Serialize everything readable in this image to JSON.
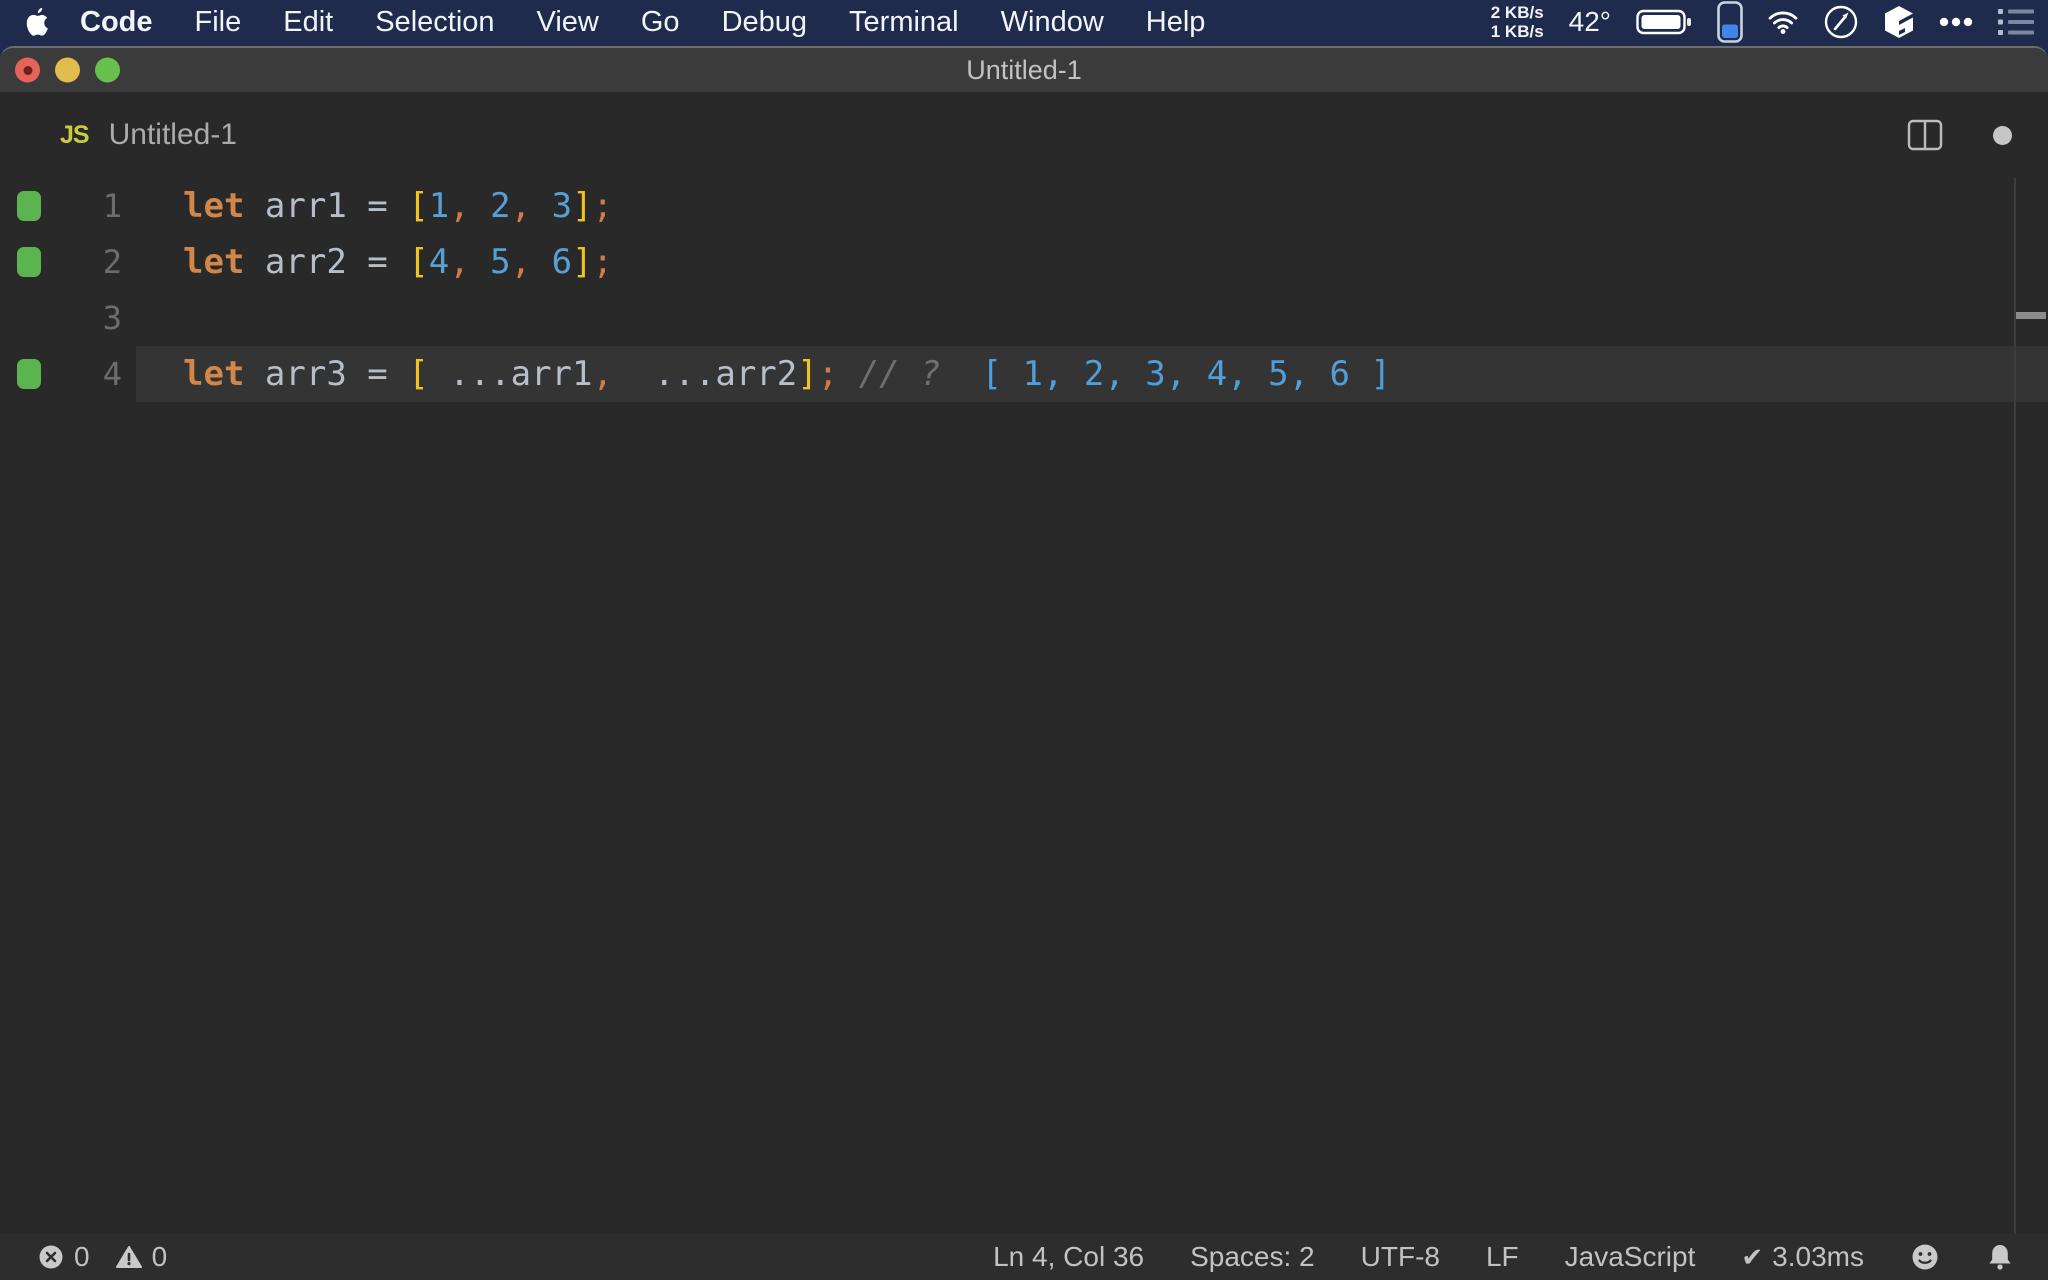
{
  "menu_bar": {
    "items": [
      {
        "label": "Code",
        "active": true
      },
      {
        "label": "File"
      },
      {
        "label": "Edit"
      },
      {
        "label": "Selection"
      },
      {
        "label": "View"
      },
      {
        "label": "Go"
      },
      {
        "label": "Debug"
      },
      {
        "label": "Terminal"
      },
      {
        "label": "Window"
      },
      {
        "label": "Help"
      }
    ],
    "status": {
      "network_up": "2 KB/s",
      "network_down": "1 KB/s",
      "temperature": "42°",
      "icons": [
        "battery-icon",
        "device-battery-icon",
        "wifi-icon",
        "compass-icon",
        "cube-icon",
        "more-dots-icon",
        "list-icon"
      ]
    }
  },
  "window": {
    "title": "Untitled-1",
    "tab": {
      "icon_label": "JS",
      "file_name": "Untitled-1"
    }
  },
  "editor": {
    "lines": [
      {
        "number": "1",
        "executed": true,
        "current": false,
        "tokens": [
          {
            "c": "keyword",
            "t": "let"
          },
          {
            "c": "plain",
            "t": " "
          },
          {
            "c": "variable",
            "t": "arr1"
          },
          {
            "c": "operator",
            "t": " = "
          },
          {
            "c": "bracket",
            "t": "["
          },
          {
            "c": "number",
            "t": "1"
          },
          {
            "c": "punct",
            "t": ", "
          },
          {
            "c": "number",
            "t": "2"
          },
          {
            "c": "punct",
            "t": ", "
          },
          {
            "c": "number",
            "t": "3"
          },
          {
            "c": "bracket",
            "t": "]"
          },
          {
            "c": "punct",
            "t": ";"
          }
        ]
      },
      {
        "number": "2",
        "executed": true,
        "current": false,
        "tokens": [
          {
            "c": "keyword",
            "t": "let"
          },
          {
            "c": "plain",
            "t": " "
          },
          {
            "c": "variable",
            "t": "arr2"
          },
          {
            "c": "operator",
            "t": " = "
          },
          {
            "c": "bracket",
            "t": "["
          },
          {
            "c": "number",
            "t": "4"
          },
          {
            "c": "punct",
            "t": ", "
          },
          {
            "c": "number",
            "t": "5"
          },
          {
            "c": "punct",
            "t": ", "
          },
          {
            "c": "number",
            "t": "6"
          },
          {
            "c": "bracket",
            "t": "]"
          },
          {
            "c": "punct",
            "t": ";"
          }
        ]
      },
      {
        "number": "3",
        "executed": false,
        "current": false,
        "tokens": []
      },
      {
        "number": "4",
        "executed": true,
        "current": true,
        "tokens": [
          {
            "c": "keyword",
            "t": "let"
          },
          {
            "c": "plain",
            "t": " "
          },
          {
            "c": "variable",
            "t": "arr3"
          },
          {
            "c": "operator",
            "t": " = "
          },
          {
            "c": "bracket",
            "t": "["
          },
          {
            "c": "plain",
            "t": " "
          },
          {
            "c": "operator",
            "t": "..."
          },
          {
            "c": "variable",
            "t": "arr1"
          },
          {
            "c": "punct",
            "t": ","
          },
          {
            "c": "plain",
            "t": "  "
          },
          {
            "c": "operator",
            "t": "..."
          },
          {
            "c": "variable",
            "t": "arr2"
          },
          {
            "c": "bracket",
            "t": "]"
          },
          {
            "c": "punct",
            "t": ";"
          },
          {
            "c": "plain",
            "t": " "
          },
          {
            "c": "comment",
            "t": "// ?"
          },
          {
            "c": "output",
            "t": "  [ 1, 2, 3, 4, 5, 6 ]"
          }
        ]
      }
    ]
  },
  "status_bar": {
    "errors": "0",
    "warnings": "0",
    "cursor_position": "Ln 4, Col 36",
    "indentation": "Spaces: 2",
    "encoding": "UTF-8",
    "eol": "LF",
    "language": "JavaScript",
    "check_icon": "✔",
    "run_time": "3.03ms"
  },
  "colors": {
    "menu_bar_bg": "#1e2b4d",
    "title_bar_bg": "#3b3b3b",
    "editor_bg": "#292929",
    "current_line_bg": "#343434",
    "status_bar_bg": "#2d2d2d",
    "traffic_red": "#e4635a",
    "traffic_yellow": "#e0bd4e",
    "traffic_green": "#68c04f",
    "gutter_green": "#5cb450",
    "keyword": "#d2874a",
    "variable": "#b6bfc9",
    "bracket": "#f0c419",
    "number": "#56a0d3",
    "punctuation": "#d17b48",
    "comment": "#6f6f6f",
    "inline_output": "#4f9fd9",
    "js_icon": "#cbcb41",
    "device_fill_blue": "#3f84e8"
  }
}
